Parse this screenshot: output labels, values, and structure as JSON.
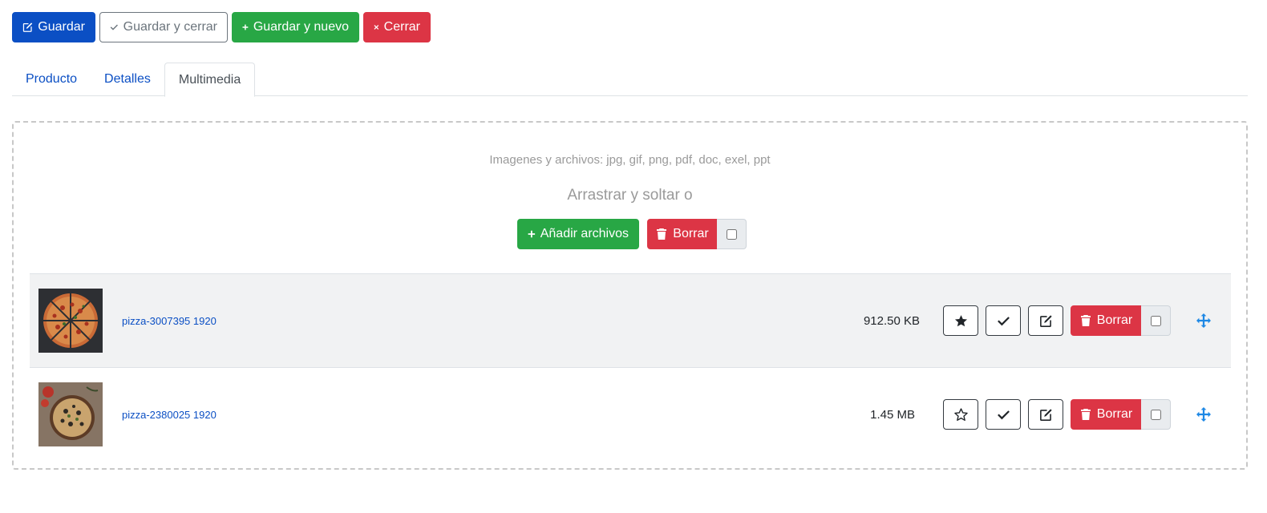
{
  "toolbar": {
    "save_label": "Guardar",
    "save_close_label": "Guardar y cerrar",
    "save_new_label": "Guardar y nuevo",
    "close_label": "Cerrar"
  },
  "tabs": [
    {
      "label": "Producto",
      "active": false
    },
    {
      "label": "Detalles",
      "active": false
    },
    {
      "label": "Multimedia",
      "active": true
    }
  ],
  "dropzone": {
    "hint": "Imagenes y archivos: jpg, gif, png, pdf, doc, exel, ppt",
    "drag_text": "Arrastrar y soltar o",
    "add_files_label": "Añadir archivos",
    "delete_label": "Borrar"
  },
  "files": [
    {
      "name": "pizza-3007395 1920",
      "size": "912.50 KB",
      "featured": true,
      "delete_label": "Borrar"
    },
    {
      "name": "pizza-2380025 1920",
      "size": "1.45 MB",
      "featured": false,
      "delete_label": "Borrar"
    }
  ],
  "icons": {
    "save": "edit-icon",
    "save_close": "check-icon",
    "save_new": "plus-icon",
    "close": "times-icon",
    "add": "plus-icon",
    "delete": "trash-icon",
    "featured": "star-icon",
    "approve": "check-icon",
    "edit": "edit-icon",
    "move": "arrows-move-icon"
  },
  "colors": {
    "primary": "#0b4fc4",
    "success": "#28a745",
    "danger": "#dc3545",
    "secondary": "#6c757d",
    "move_icon": "#1e88e5"
  }
}
